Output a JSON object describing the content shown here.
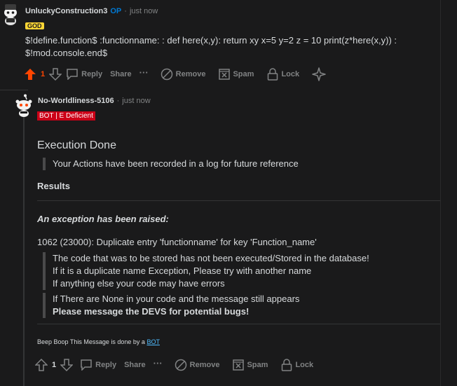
{
  "comment1": {
    "username": "UnluckyConstruction3",
    "op_label": "OP",
    "separator": "·",
    "time": "just now",
    "flair": "GOD",
    "body_line1": "$!define.function$ :functionname: : def here(x,y): return xy x=5 y=2 z = 10 print(z*here(x,y)) :",
    "body_line2": "$!mod.console.end$",
    "score": "1",
    "actions": {
      "reply": "Reply",
      "share": "Share",
      "more": "···",
      "remove": "Remove",
      "spam": "Spam",
      "lock": "Lock"
    },
    "colors": {
      "upvote": "#ff4500"
    }
  },
  "comment2": {
    "username": "No-Worldliness-5106",
    "separator": "·",
    "time": "just now",
    "flair": "BOT | E Deficient",
    "heading": "Execution Done",
    "quote_log": "Your Actions have been recorded in a log for future reference",
    "results": "Results",
    "exception": "An exception has been raised:",
    "error_line": "1062 (23000): Duplicate entry 'functionname' for key 'Function_name'",
    "quote_lines": [
      "The code that was to be stored has not been executed/Stored in the database!",
      "If it is a duplicate name Exception, Please try with another name",
      "If anything else your code may have errors"
    ],
    "quote2_line1": "If There are None in your code and the message still appears",
    "quote2_line2": "Please message the DEVS for potential bugs!",
    "footer_text": "Beep Boop This Message is done by a",
    "footer_link": "BOT",
    "score": "1",
    "actions": {
      "reply": "Reply",
      "share": "Share",
      "more": "···",
      "remove": "Remove",
      "spam": "Spam",
      "lock": "Lock"
    }
  }
}
